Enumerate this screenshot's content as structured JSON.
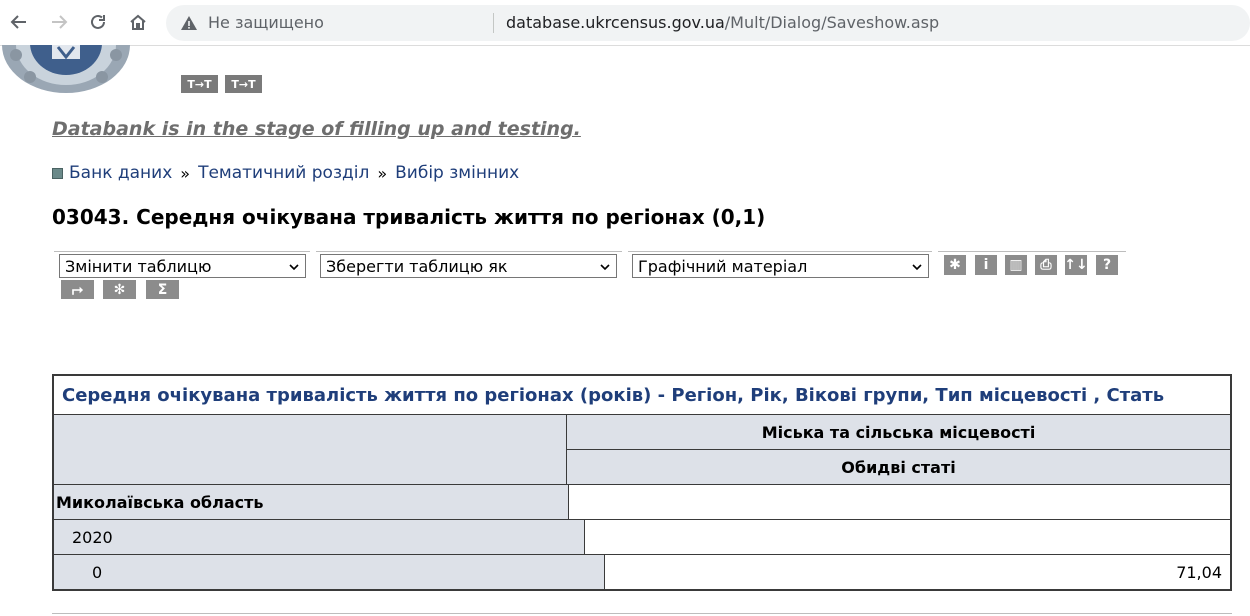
{
  "browser": {
    "security_label": "Не защищено",
    "url_domain": "database.ukrcensus.gov.ua",
    "url_path": "/Mult/Dialog/Saveshow.asp"
  },
  "header": {
    "tt_buttons": [
      "T→T",
      "T→T"
    ]
  },
  "notice": "Databank is in the stage of filling up and testing.",
  "breadcrumb": {
    "items": [
      "Банк даних",
      "Тематичний розділ",
      "Вибір змінних"
    ],
    "separator": "»"
  },
  "page_title": "03043. Середня очікувана тривалість життя по регіонах (0,1)",
  "toolbar": {
    "selects": [
      "Змінити таблицю",
      "Зберегти таблицю як",
      "Графічний матеріал"
    ],
    "icon_buttons_row1": [
      "✱",
      "i",
      "▥",
      "⎙",
      "↑↓",
      "?"
    ],
    "icon_buttons_row2": [
      "⮣",
      "✻",
      "Σ"
    ]
  },
  "table": {
    "title": "Середня очікувана тривалість життя по регіонах (років) - Регіон, Рік, Вікові групи, Тип місцевості , Стать",
    "col_header_1": "Міська та сільська місцевості",
    "col_header_2": "Обидві статі",
    "rows": [
      {
        "label": "Миколаївська область",
        "value": ""
      },
      {
        "label": "2020",
        "value": ""
      },
      {
        "label": "0",
        "value": "71,04"
      }
    ]
  }
}
